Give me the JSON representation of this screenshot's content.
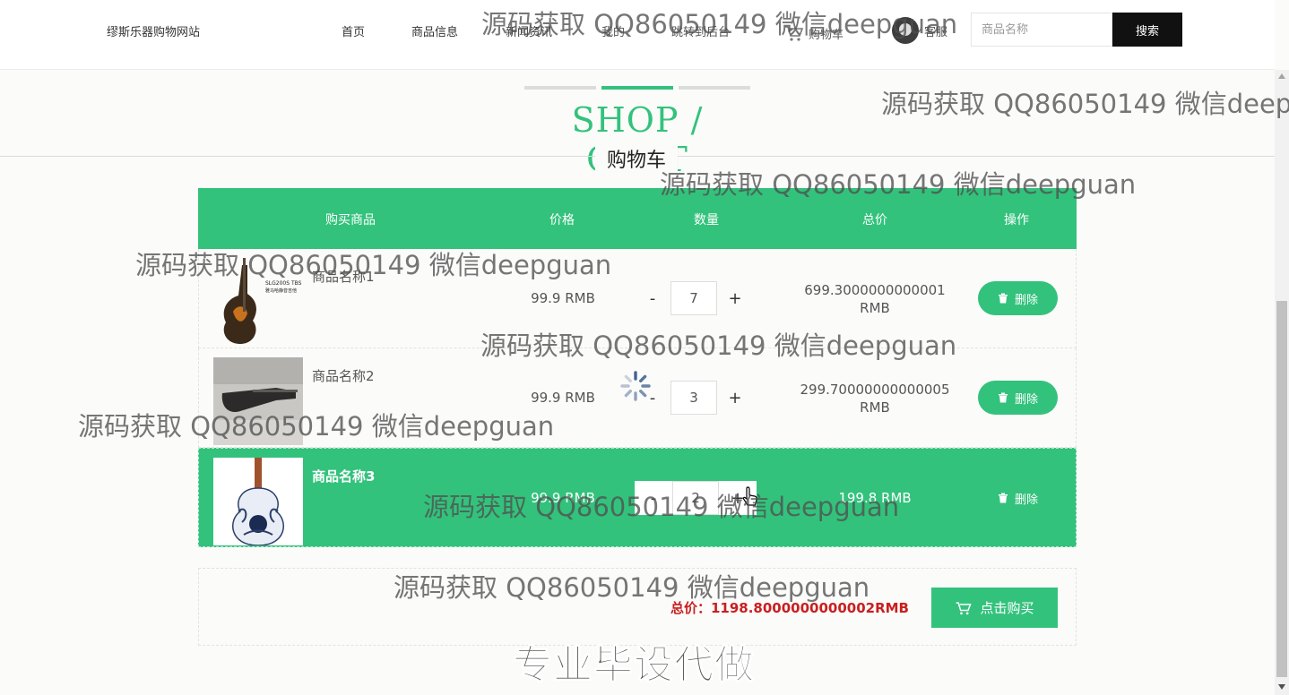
{
  "header": {
    "brand": "缪斯乐器购物网站",
    "nav": [
      "首页",
      "商品信息",
      "新闻资讯",
      "我的",
      "跳转到后台"
    ],
    "cart": "购物车",
    "service": "客服",
    "search_placeholder": "商品名称",
    "search_button": "搜索"
  },
  "title": {
    "en": "SHOP / CART",
    "cn": "购物车"
  },
  "table": {
    "headers": [
      "购买商品",
      "价格",
      "数量",
      "总价",
      "操作"
    ],
    "rows": [
      {
        "name": "商品名称1",
        "price": "99.9 RMB",
        "qty": "7",
        "total_line1": "699.3000000000001",
        "total_line2": "RMB",
        "delete": "删除"
      },
      {
        "name": "商品名称2",
        "price": "99.9 RMB",
        "qty": "3",
        "total_line1": "299.70000000000005",
        "total_line2": "RMB",
        "delete": "删除"
      },
      {
        "name": "商品名称3",
        "price": "99.9 RMB",
        "qty": "2",
        "total_line1": "199.8 RMB",
        "total_line2": "",
        "delete": "删除"
      }
    ]
  },
  "summary": {
    "total": "总价：1198.8000000000002RMB",
    "buy_button": "点击购买"
  },
  "watermarks": {
    "text": "源码获取 QQ86050149 微信deepguan",
    "text_cut": "源码获取 QQ86050149 微信deep",
    "banner": "专业毕设代做"
  },
  "colors": {
    "accent": "#33c27c",
    "total_red": "#c91f1f",
    "search_button": "#111111"
  }
}
